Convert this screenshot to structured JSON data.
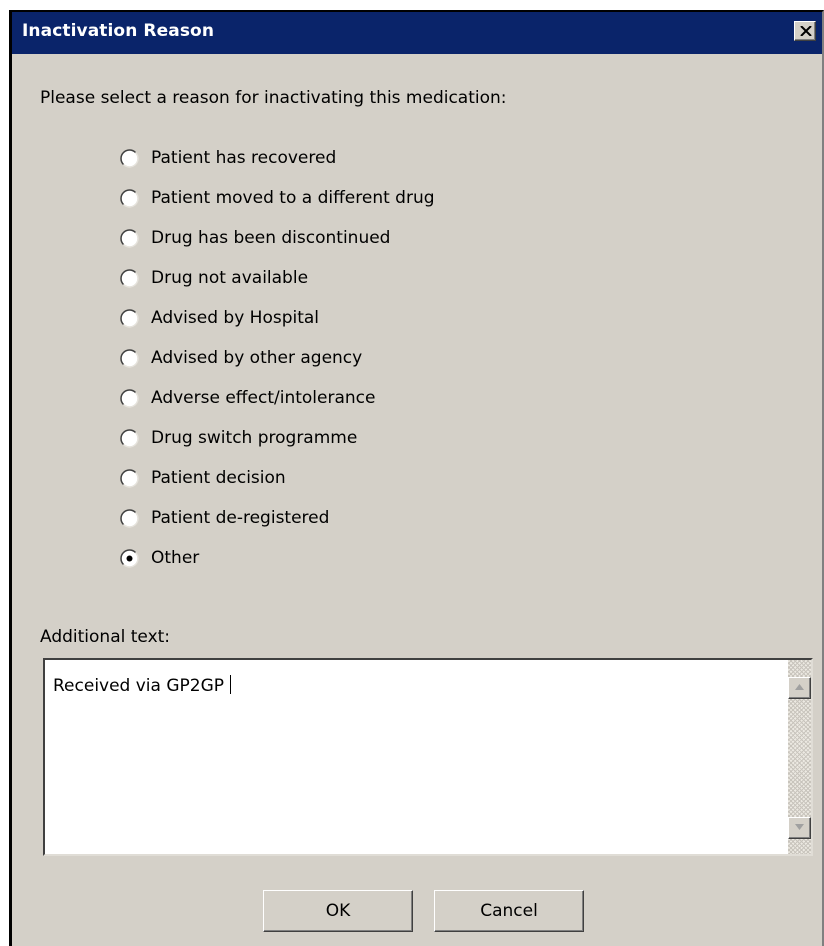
{
  "window": {
    "title": "Inactivation Reason",
    "close_icon": "close-x-icon"
  },
  "prompt": "Please select a reason for inactivating this medication:",
  "reasons": [
    {
      "label": "Patient has recovered",
      "selected": false
    },
    {
      "label": "Patient moved to a different drug",
      "selected": false
    },
    {
      "label": "Drug has been discontinued",
      "selected": false
    },
    {
      "label": "Drug not available",
      "selected": false
    },
    {
      "label": "Advised by Hospital",
      "selected": false
    },
    {
      "label": "Advised by other agency",
      "selected": false
    },
    {
      "label": "Adverse effect/intolerance",
      "selected": false
    },
    {
      "label": "Drug switch programme",
      "selected": false
    },
    {
      "label": "Patient decision",
      "selected": false
    },
    {
      "label": "Patient de-registered",
      "selected": false
    },
    {
      "label": "Other",
      "selected": true
    }
  ],
  "additional": {
    "label": "Additional text:",
    "value": "Received via GP2GP"
  },
  "buttons": {
    "ok": "OK",
    "cancel": "Cancel"
  },
  "colors": {
    "titlebar": "#0a246a",
    "dialog_bg": "#d4d0c8"
  }
}
